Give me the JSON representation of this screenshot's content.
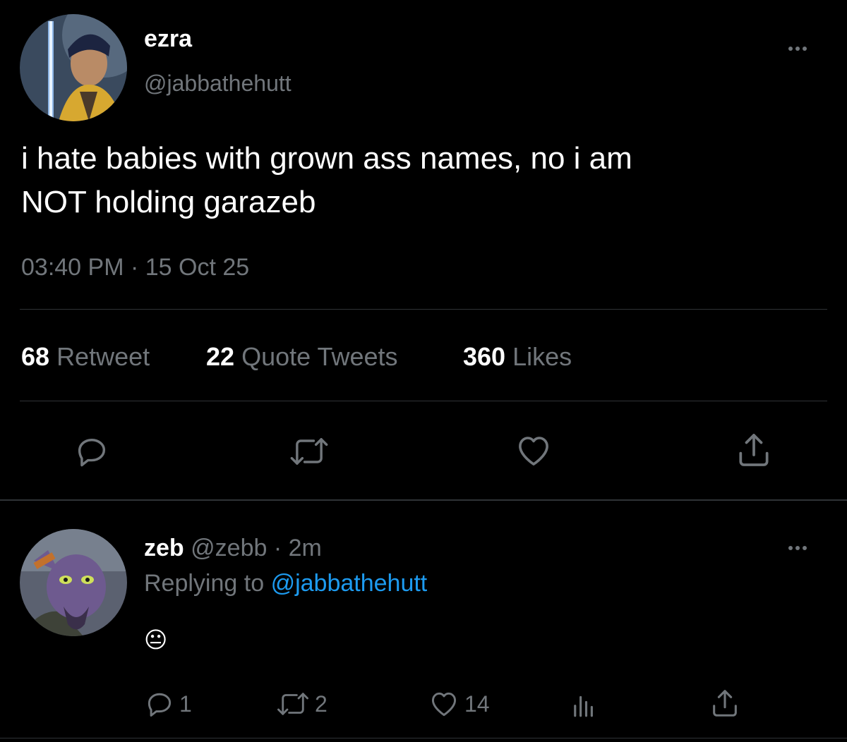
{
  "main_tweet": {
    "display_name": "ezra",
    "handle": "@jabbathehutt",
    "text_line1": "i hate babies with grown ass names, no i am",
    "text_line2": "NOT holding garazeb",
    "time": "03:40 PM",
    "separator": "·",
    "date": "15 Oct 25",
    "stats": {
      "retweets_count": "68",
      "retweets_label": "Retweet",
      "quotes_count": "22",
      "quotes_label": "Quote Tweets",
      "likes_count": "360",
      "likes_label": "Likes"
    }
  },
  "reply": {
    "display_name": "zeb",
    "handle": "@zebb",
    "separator": "·",
    "age": "2m",
    "replying_prefix": "Replying to",
    "replying_handle": "@jabbathehutt",
    "text": "😐",
    "counts": {
      "replies": "1",
      "retweets": "2",
      "likes": "14"
    }
  },
  "colors": {
    "background": "#000000",
    "text": "#ffffff",
    "muted": "#71767b",
    "link": "#1d9bf0",
    "divider": "#2f3336"
  },
  "icons": {
    "main_actions": [
      "reply-icon",
      "retweet-icon",
      "like-icon",
      "share-icon"
    ],
    "reply_actions": [
      "reply-icon",
      "retweet-icon",
      "like-icon",
      "analytics-icon",
      "share-icon"
    ],
    "menus": [
      "more-icon"
    ]
  }
}
